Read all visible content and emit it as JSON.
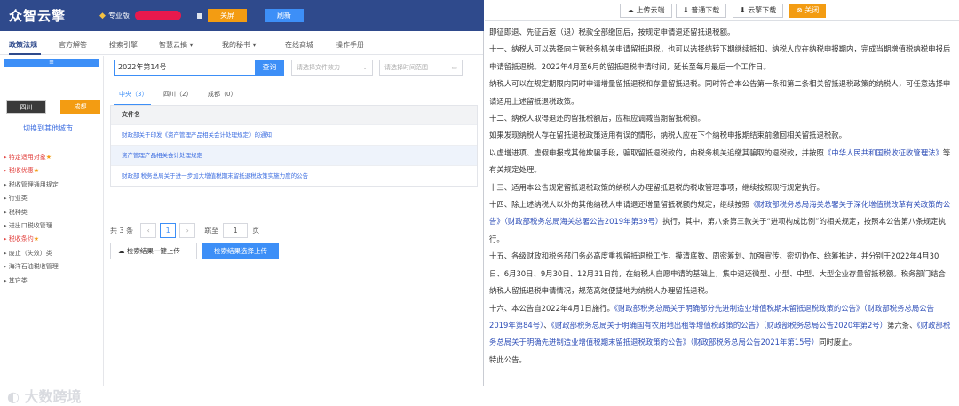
{
  "header": {
    "brand": "众智云擎",
    "pro_label": "专业版",
    "btn_close_screen": "关屏",
    "btn_refresh": "刷新"
  },
  "nav": {
    "items": [
      "政策法规",
      "官方解答",
      "搜索引擎",
      "智慧云搞 ▾",
      "我的秘书 ▾",
      "在线商城",
      "操作手册"
    ]
  },
  "sidebar": {
    "bar_symbol": "≡",
    "region_left": "四川",
    "region_right": "成都",
    "switch_city": "切换到其他城市",
    "categories": [
      {
        "label": "特定适用对象",
        "star": "★",
        "highlight": true
      },
      {
        "label": "税收优惠",
        "star": "★",
        "highlight": true
      },
      {
        "label": "税收管理通用规定",
        "star": "",
        "highlight": false
      },
      {
        "label": "行业类",
        "star": "",
        "highlight": false
      },
      {
        "label": "税种类",
        "star": "",
        "highlight": false
      },
      {
        "label": "进出口税收管理",
        "star": "",
        "highlight": false
      },
      {
        "label": "税收条约",
        "star": "★",
        "highlight": true
      },
      {
        "label": "废止（失效）类",
        "star": "",
        "highlight": false
      },
      {
        "label": "海洋石油税收管理",
        "star": "",
        "highlight": false
      },
      {
        "label": "其它类",
        "star": "",
        "highlight": false
      }
    ]
  },
  "search": {
    "query": "2022年第14号",
    "button": "查询",
    "select_effect": "请选择文件效力",
    "select_time": "请选择时间范围"
  },
  "tabs": [
    "中央（3）",
    "四川（2）",
    "成都（0）"
  ],
  "table": {
    "header": "文件名",
    "rows": [
      "财政部关于印发《资产管理产品相关会计处理规定》的通知",
      "资产管理产品相关会计处理规定",
      "财政部 税务总局关于进一步加大增值税期末留抵退税政策实施力度的公告"
    ]
  },
  "pager": {
    "total": "共 3 条",
    "prev": "‹",
    "current": "1",
    "next": "›",
    "jump": "跳至",
    "page_input": "1",
    "page_unit": "页"
  },
  "actions": {
    "upload_all": "检索结果一键上传",
    "upload_selected": "检索结果选择上传"
  },
  "watermark": "大数跨境",
  "right_toolbar": {
    "upload_cloud": "上传云端",
    "normal_download": "普通下载",
    "cloud_download": "云擎下载",
    "close": "关闭"
  },
  "doc": {
    "p1": "即征即退、先征后返（退）税款全部缴回后，按规定申请退还留抵退税额。",
    "p2": "十一、纳税人可以选择向主管税务机关申请留抵退税，也可以选择结转下期继续抵扣。纳税人应在纳税申报期内，完成当期增值税纳税申报后申请留抵退税。2022年4月至6月的留抵退税申请时间，延长至每月最后一个工作日。",
    "p3": "纳税人可以在规定期限内同时申请增量留抵退税和存量留抵退税。同时符合本公告第一条和第二条相关留抵退税政策的纳税人，可任意选择申请适用上述留抵退税政策。",
    "p4": "十二、纳税人取得退还的留抵税额后，应相应调减当期留抵税额。",
    "p5": "如果发现纳税人存在留抵退税政策适用有误的情形，纳税人应在下个纳税申报期结束前缴回相关留抵退税款。",
    "p6a": "以虚增进项、虚假申报或其他欺骗手段，骗取留抵退税款的，由税务机关追缴其骗取的退税款，并按照",
    "p6link": "《中华人民共和国税收征收管理法》",
    "p6b": "等有关规定处理。",
    "p7": "十三、适用本公告规定留抵退税政策的纳税人办理留抵退税的税收管理事项，继续按照现行规定执行。",
    "p8a": "十四、除上述纳税人以外的其他纳税人申请退还增量留抵税额的规定，继续按照",
    "p8link": "《财政部税务总局海关总署关于深化增值税改革有关政策的公告》（财政部税务总局海关总署公告2019年第39号）",
    "p8b": "执行，其中，第八条第三款关于“进项构成比例”的相关规定，按照本公告第八条规定执行。",
    "p9": "十五、各级财政和税务部门务必高度重视留抵退税工作，摸清底数、周密筹划、加强宣传、密切协作、统筹推进，并分别于2022年4月30日、6月30日、9月30日、12月31日前，在纳税人自愿申请的基础上，集中退还微型、小型、中型、大型企业存量留抵税额。税务部门结合纳税人留抵退税申请情况，规范高效便捷地为纳税人办理留抵退税。",
    "p10a": "十六、本公告自2022年4月1日施行。",
    "p10link1": "《财政部税务总局关于明确部分先进制造业增值税期末留抵退税政策的公告》（财政部税务总局公告2019年第84号）",
    "p10c": "、",
    "p10link2": "《财政部税务总局关于明确国有农用地出租等增值税政策的公告》（财政部税务总局公告2020年第2号）",
    "p10d": "第六条、",
    "p10link3": "《财政部税务总局关于明确先进制造业增值税期末留抵退税政策的公告》（财政部税务总局公告2021年第15号）",
    "p10e": "同时废止。",
    "p11": "特此公告。"
  }
}
